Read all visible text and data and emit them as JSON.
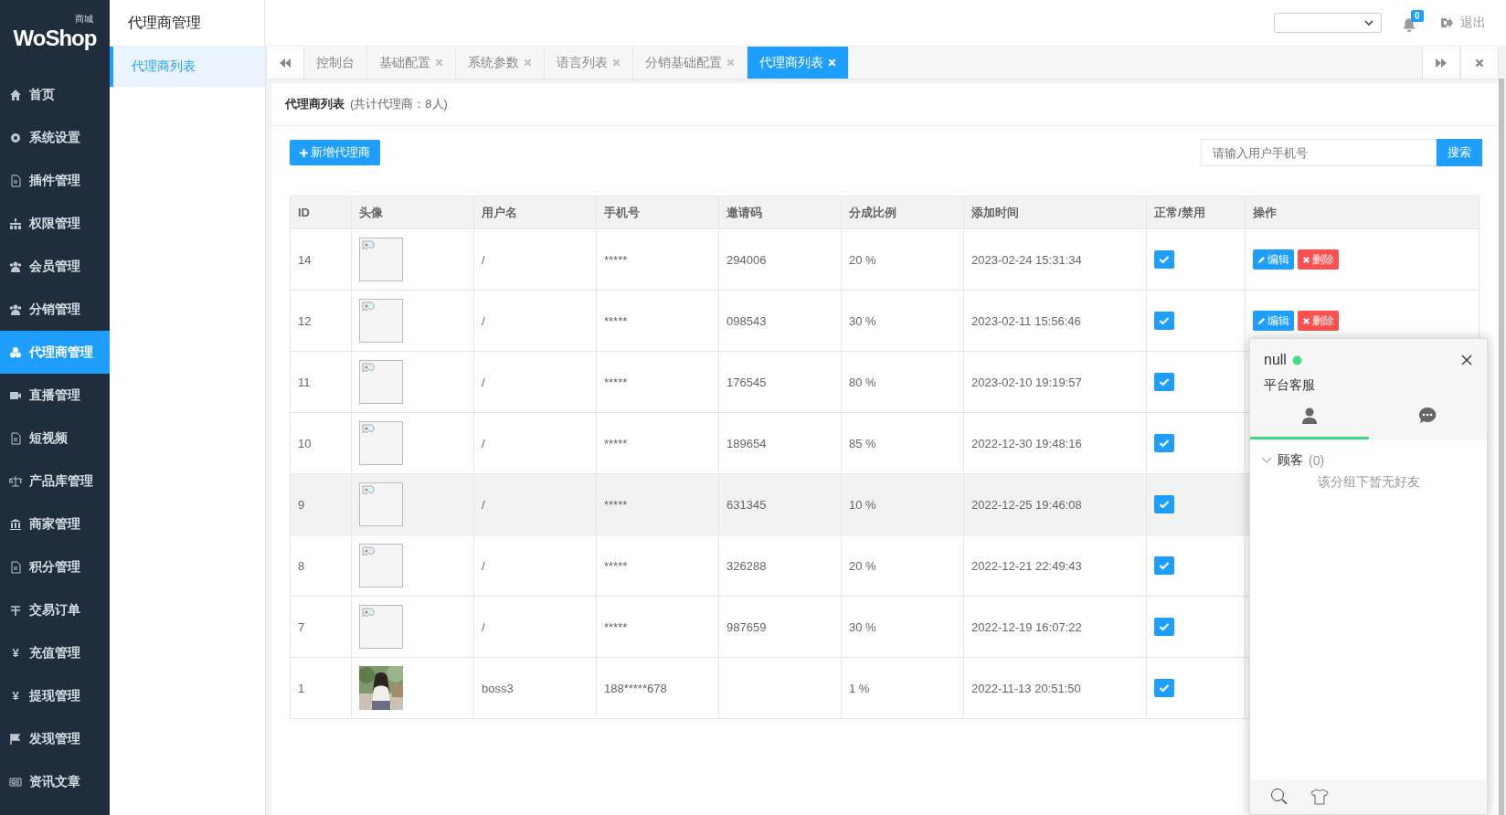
{
  "logo": {
    "name": "WoShop",
    "tag": "商城"
  },
  "header": {
    "title": "代理商管理",
    "notifications": "0",
    "logout": "退出"
  },
  "sidebar": {
    "items": [
      {
        "label": "首页",
        "selected": false
      },
      {
        "label": "系统设置",
        "selected": false
      },
      {
        "label": "插件管理",
        "selected": false
      },
      {
        "label": "权限管理",
        "selected": false
      },
      {
        "label": "会员管理",
        "selected": false
      },
      {
        "label": "分销管理",
        "selected": false
      },
      {
        "label": "代理商管理",
        "selected": true
      },
      {
        "label": "直播管理",
        "selected": false
      },
      {
        "label": "短视频",
        "selected": false
      },
      {
        "label": "产品库管理",
        "selected": false
      },
      {
        "label": "商家管理",
        "selected": false
      },
      {
        "label": "积分管理",
        "selected": false
      },
      {
        "label": "交易订单",
        "selected": false
      },
      {
        "label": "充值管理",
        "selected": false,
        "icon_text": "¥"
      },
      {
        "label": "提现管理",
        "selected": false,
        "icon_text": "¥"
      },
      {
        "label": "发现管理",
        "selected": false
      },
      {
        "label": "资讯文章",
        "selected": false
      }
    ]
  },
  "subnav": {
    "items": [
      {
        "label": "代理商列表",
        "selected": true
      }
    ]
  },
  "tabs": [
    {
      "label": "控制台",
      "closable": false,
      "selected": false
    },
    {
      "label": "基础配置",
      "closable": true,
      "selected": false
    },
    {
      "label": "系统参数",
      "closable": true,
      "selected": false
    },
    {
      "label": "语言列表",
      "closable": true,
      "selected": false
    },
    {
      "label": "分销基础配置",
      "closable": true,
      "selected": false
    },
    {
      "label": "代理商列表",
      "closable": true,
      "selected": true
    }
  ],
  "panel": {
    "title": "代理商列表",
    "summary": "(共计代理商：8人)",
    "add_button": "新增代理商",
    "search": {
      "placeholder": "请输入用户手机号",
      "button": "搜索"
    }
  },
  "table": {
    "columns": [
      "ID",
      "头像",
      "用户名",
      "手机号",
      "邀请码",
      "分成比例",
      "添加时间",
      "正常/禁用",
      "操作"
    ],
    "rows": [
      {
        "id": "14",
        "avatar": {
          "kind": "broken_image"
        },
        "username": "/",
        "phone": "*****",
        "invite_code": "294006",
        "ratio": "20 %",
        "added": "2023-02-24 15:31:34",
        "enabled": true,
        "hovered": false,
        "actions": [
          {
            "kind": "edit",
            "label": "编辑"
          },
          {
            "kind": "delete",
            "label": "删除"
          }
        ]
      },
      {
        "id": "12",
        "avatar": {
          "kind": "broken_image"
        },
        "username": "/",
        "phone": "*****",
        "invite_code": "098543",
        "ratio": "30 %",
        "added": "2023-02-11 15:56:46",
        "enabled": true,
        "hovered": false,
        "actions": [
          {
            "kind": "edit",
            "label": "编辑"
          },
          {
            "kind": "delete",
            "label": "删除"
          }
        ]
      },
      {
        "id": "11",
        "avatar": {
          "kind": "broken_image"
        },
        "username": "/",
        "phone": "*****",
        "invite_code": "176545",
        "ratio": "80 %",
        "added": "2023-02-10 19:19:57",
        "enabled": true,
        "hovered": false
      },
      {
        "id": "10",
        "avatar": {
          "kind": "broken_image"
        },
        "username": "/",
        "phone": "*****",
        "invite_code": "189654",
        "ratio": "85 %",
        "added": "2022-12-30 19:48:16",
        "enabled": true,
        "hovered": false
      },
      {
        "id": "9",
        "avatar": {
          "kind": "broken_image"
        },
        "username": "/",
        "phone": "*****",
        "invite_code": "631345",
        "ratio": "10 %",
        "added": "2022-12-25 19:46:08",
        "enabled": true,
        "hovered": true
      },
      {
        "id": "8",
        "avatar": {
          "kind": "broken_image"
        },
        "username": "/",
        "phone": "*****",
        "invite_code": "326288",
        "ratio": "20 %",
        "added": "2022-12-21 22:49:43",
        "enabled": true,
        "hovered": false
      },
      {
        "id": "7",
        "avatar": {
          "kind": "broken_image"
        },
        "username": "/",
        "phone": "*****",
        "invite_code": "987659",
        "ratio": "30 %",
        "added": "2022-12-19 16:07:22",
        "enabled": true,
        "hovered": false
      },
      {
        "id": "1",
        "username": "boss3",
        "phone": "188*****678",
        "ratio": "1 %",
        "added": "2022-11-13 20:51:50",
        "enabled": true,
        "hovered": false
      }
    ]
  },
  "chat": {
    "name": "null",
    "online": true,
    "subtitle": "平台客服",
    "tabs": [
      {
        "kind": "contacts",
        "selected": true
      },
      {
        "kind": "chats",
        "selected": false
      }
    ],
    "group": {
      "label": "顾客",
      "count": "(0)",
      "expanded": true
    },
    "empty": "该分组下暂无好友"
  }
}
